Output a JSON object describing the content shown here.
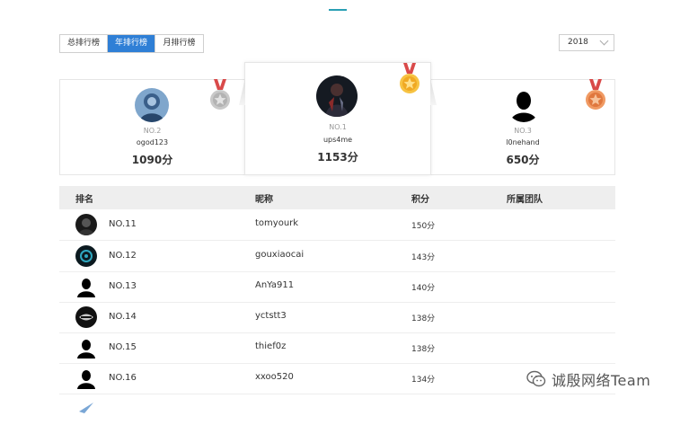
{
  "tabs": [
    "总排行榜",
    "年排行榜",
    "月排行榜"
  ],
  "active_tab": "年排行榜",
  "year_select": {
    "value": "2018"
  },
  "podium": [
    {
      "rank": "NO.2",
      "nickname": "ogod123",
      "score": "1090分",
      "medal": "silver-medal-icon",
      "color": "#b8b8b8"
    },
    {
      "rank": "NO.1",
      "nickname": "ups4me",
      "score": "1153分",
      "medal": "gold-medal-icon",
      "color": "#f5b62a"
    },
    {
      "rank": "NO.3",
      "nickname": "l0nehand",
      "score": "650分",
      "medal": "bronze-medal-icon",
      "color": "#e8824c"
    }
  ],
  "table": {
    "headers": {
      "rank": "排名",
      "nickname": "昵称",
      "score": "积分",
      "team": "所属团队"
    },
    "rows": [
      {
        "rank": "NO.11",
        "nickname": "tomyourk",
        "score": "150分",
        "team": ""
      },
      {
        "rank": "NO.12",
        "nickname": "gouxiaocai",
        "score": "143分",
        "team": ""
      },
      {
        "rank": "NO.13",
        "nickname": "AnYa911",
        "score": "140分",
        "team": ""
      },
      {
        "rank": "NO.14",
        "nickname": "yctstt3",
        "score": "138分",
        "team": ""
      },
      {
        "rank": "NO.15",
        "nickname": "thief0z",
        "score": "138分",
        "team": ""
      },
      {
        "rank": "NO.16",
        "nickname": "xxoo520",
        "score": "134分",
        "team": ""
      }
    ]
  },
  "watermark": {
    "text": "诚殷网络Team"
  },
  "colors": {
    "accent": "#2f7fd6",
    "header_bg": "#eeeeee"
  }
}
